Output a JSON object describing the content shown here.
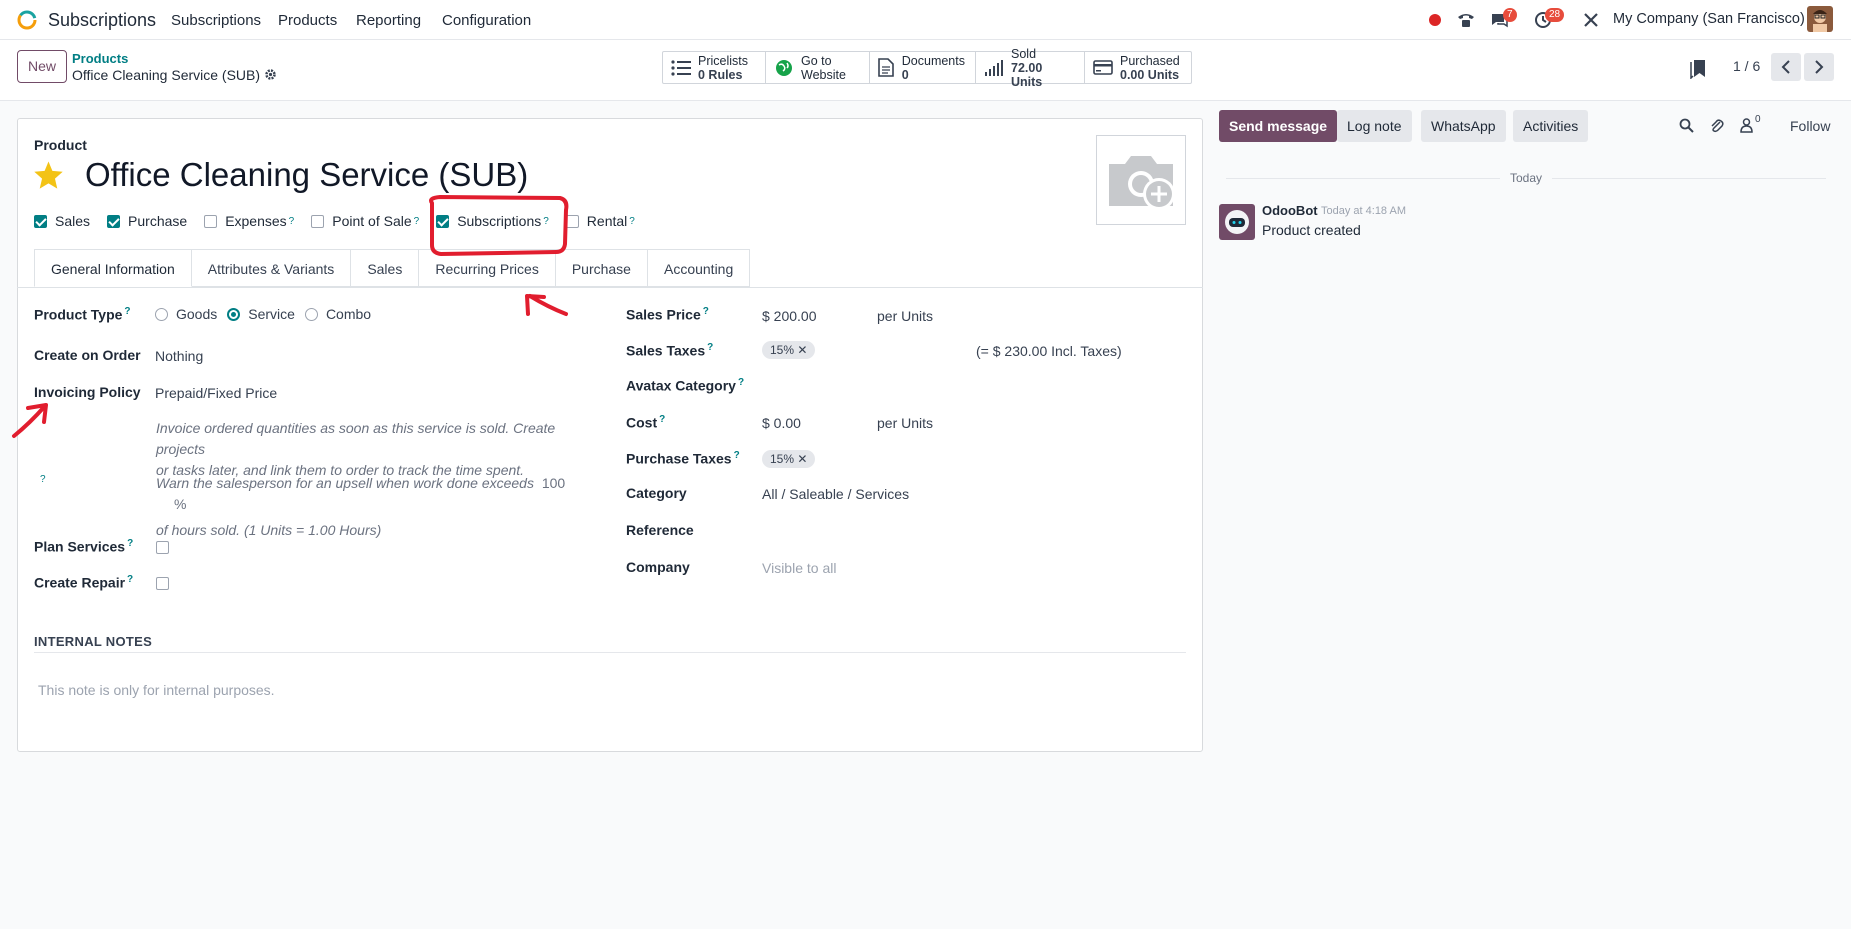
{
  "navbar": {
    "app_name": "Subscriptions",
    "menu": [
      "Subscriptions",
      "Products",
      "Reporting",
      "Configuration"
    ],
    "chat_badge": "7",
    "activity_badge": "28",
    "company": "My Company (San Francisco)"
  },
  "control": {
    "new_label": "New",
    "breadcrumb_parent": "Products",
    "breadcrumb_current": "Office Cleaning Service (SUB)",
    "smart_buttons": [
      {
        "line1": "Pricelists",
        "line2": "0 Rules"
      },
      {
        "line1": "Go to",
        "line2": "Website"
      },
      {
        "line1": "Documents",
        "line2": "0"
      },
      {
        "line1": "Sold",
        "line2": "72.00 Units"
      },
      {
        "line1": "Purchased",
        "line2": "0.00 Units"
      }
    ],
    "pager": "1 / 6"
  },
  "form": {
    "product_label": "Product",
    "product_name": "Office Cleaning Service (SUB)",
    "flags": [
      {
        "label": "Sales",
        "checked": true
      },
      {
        "label": "Purchase",
        "checked": true
      },
      {
        "label": "Expenses",
        "checked": false
      },
      {
        "label": "Point of Sale",
        "checked": false
      },
      {
        "label": "Subscriptions",
        "checked": true
      },
      {
        "label": "Rental",
        "checked": false
      }
    ],
    "tabs": [
      "General Information",
      "Attributes & Variants",
      "Sales",
      "Recurring Prices",
      "Purchase",
      "Accounting"
    ],
    "left": {
      "product_type_label": "Product Type",
      "product_type_options": [
        "Goods",
        "Service",
        "Combo"
      ],
      "create_on_order_label": "Create on Order",
      "create_on_order_value": "Nothing",
      "invoicing_policy_label": "Invoicing Policy",
      "invoicing_policy_value": "Prepaid/Fixed Price",
      "invoicing_help_1": "Invoice ordered quantities as soon as this service is sold. Create projects",
      "invoicing_help_2": "or tasks later, and link them to order to track the time spent.",
      "upsell_text": "Warn the salesperson for an upsell when work done exceeds",
      "upsell_value": "100",
      "upsell_unit": "%",
      "upsell_text_2": "of hours sold. (1 Units = 1.00 Hours)",
      "plan_services_label": "Plan Services",
      "create_repair_label": "Create Repair"
    },
    "right": {
      "sales_price_label": "Sales Price",
      "sales_price_value": "$ 200.00",
      "sales_price_unit": "per Units",
      "sales_taxes_label": "Sales Taxes",
      "sales_taxes_tag": "15%",
      "sales_taxes_incl": "(= $ 230.00 Incl. Taxes)",
      "avatax_label": "Avatax Category",
      "cost_label": "Cost",
      "cost_value": "$ 0.00",
      "cost_unit": "per Units",
      "purchase_taxes_label": "Purchase Taxes",
      "purchase_taxes_tag": "15%",
      "category_label": "Category",
      "category_value": "All / Saleable / Services",
      "reference_label": "Reference",
      "company_label": "Company",
      "company_placeholder": "Visible to all"
    },
    "internal_notes_label": "INTERNAL NOTES",
    "internal_notes_placeholder": "This note is only for internal purposes."
  },
  "chatter": {
    "send_message": "Send message",
    "log_note": "Log note",
    "whatsapp": "WhatsApp",
    "activities": "Activities",
    "followers_count": "0",
    "follow": "Follow",
    "day_separator": "Today",
    "messages": [
      {
        "author": "OdooBot",
        "time": "Today at 4:18 AM",
        "body": "Product created"
      }
    ]
  }
}
